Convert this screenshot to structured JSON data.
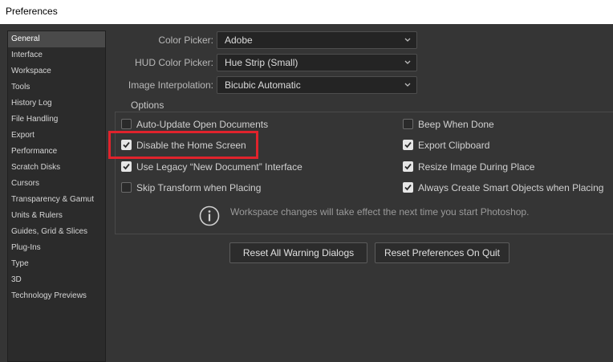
{
  "window": {
    "title": "Preferences"
  },
  "sidebar": {
    "items": [
      {
        "label": "General",
        "active": true
      },
      {
        "label": "Interface"
      },
      {
        "label": "Workspace"
      },
      {
        "label": "Tools"
      },
      {
        "label": "History Log"
      },
      {
        "label": "File Handling"
      },
      {
        "label": "Export"
      },
      {
        "label": "Performance"
      },
      {
        "label": "Scratch Disks"
      },
      {
        "label": "Cursors"
      },
      {
        "label": "Transparency & Gamut"
      },
      {
        "label": "Units & Rulers"
      },
      {
        "label": "Guides, Grid & Slices"
      },
      {
        "label": "Plug-Ins"
      },
      {
        "label": "Type"
      },
      {
        "label": "3D"
      },
      {
        "label": "Technology Previews"
      }
    ]
  },
  "fields": {
    "color_picker": {
      "label": "Color Picker:",
      "value": "Adobe"
    },
    "hud_color_picker": {
      "label": "HUD Color Picker:",
      "value": "Hue Strip (Small)"
    },
    "image_interpolation": {
      "label": "Image Interpolation:",
      "value": "Bicubic Automatic"
    }
  },
  "options": {
    "title": "Options",
    "left": [
      {
        "label": "Auto-Update Open Documents",
        "checked": false
      },
      {
        "label": "Disable the Home Screen",
        "checked": true
      },
      {
        "label": "Use Legacy “New Document” Interface",
        "checked": true
      },
      {
        "label": "Skip Transform when Placing",
        "checked": false
      }
    ],
    "right": [
      {
        "label": "Beep When Done",
        "checked": false
      },
      {
        "label": "Export Clipboard",
        "checked": true
      },
      {
        "label": "Resize Image During Place",
        "checked": true
      },
      {
        "label": "Always Create Smart Objects when Placing",
        "checked": true
      }
    ],
    "info_text": "Workspace changes will take effect the next time you start Photoshop."
  },
  "buttons": {
    "reset_warnings": "Reset All Warning Dialogs",
    "reset_on_quit": "Reset Preferences On Quit"
  },
  "colors": {
    "background": "#353535",
    "highlight": "#e0232c"
  },
  "icons": {
    "dropdown": "chevron-down-icon",
    "checkbox": "checkmark-icon",
    "info": "info-icon"
  }
}
